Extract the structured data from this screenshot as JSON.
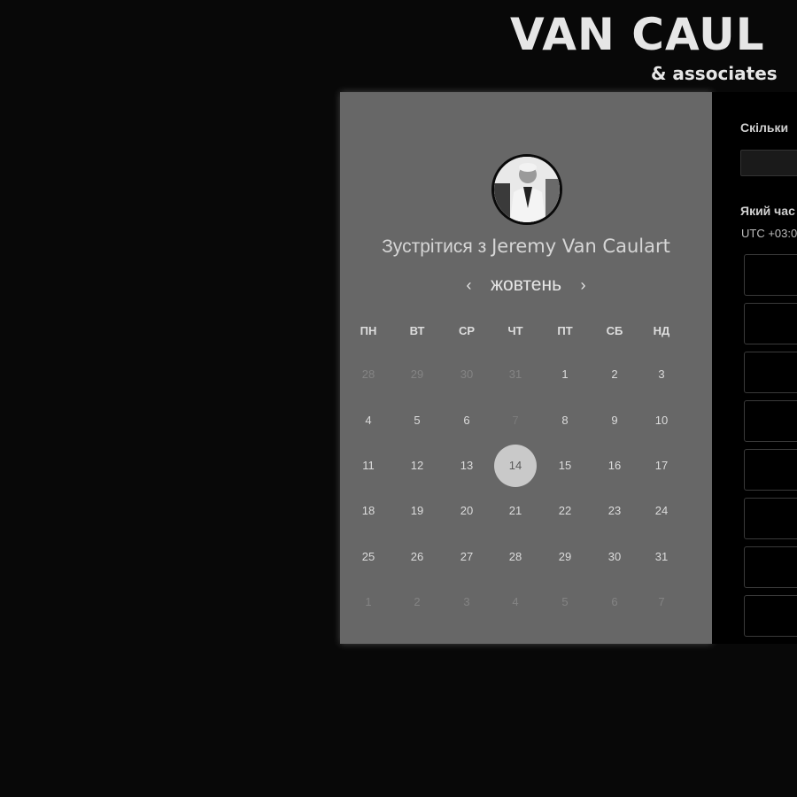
{
  "brand": {
    "logo_main": "VAN CAUL",
    "logo_sub": "& associates"
  },
  "booking": {
    "meet_prefix": "Зустрітися з",
    "host_name": "Jeremy Van Caulart",
    "month": "жовтень",
    "prev_icon": "‹",
    "next_icon": "›"
  },
  "calendar": {
    "weekdays": [
      "ПН",
      "ВТ",
      "СР",
      "ЧТ",
      "ПТ",
      "СБ",
      "НД"
    ],
    "selected_day": "14",
    "weeks": [
      [
        {
          "d": "28",
          "s": "muted"
        },
        {
          "d": "29",
          "s": "muted"
        },
        {
          "d": "30",
          "s": "muted"
        },
        {
          "d": "31",
          "s": "muted"
        },
        {
          "d": "1",
          "s": "normal"
        },
        {
          "d": "2",
          "s": "normal"
        },
        {
          "d": "3",
          "s": "normal"
        }
      ],
      [
        {
          "d": "4",
          "s": "normal"
        },
        {
          "d": "5",
          "s": "normal"
        },
        {
          "d": "6",
          "s": "normal"
        },
        {
          "d": "7",
          "s": "disabled"
        },
        {
          "d": "8",
          "s": "normal"
        },
        {
          "d": "9",
          "s": "normal"
        },
        {
          "d": "10",
          "s": "normal"
        }
      ],
      [
        {
          "d": "11",
          "s": "normal"
        },
        {
          "d": "12",
          "s": "normal"
        },
        {
          "d": "13",
          "s": "normal"
        },
        {
          "d": "14",
          "s": "selected"
        },
        {
          "d": "15",
          "s": "normal"
        },
        {
          "d": "16",
          "s": "normal"
        },
        {
          "d": "17",
          "s": "normal"
        }
      ],
      [
        {
          "d": "18",
          "s": "normal"
        },
        {
          "d": "19",
          "s": "normal"
        },
        {
          "d": "20",
          "s": "normal"
        },
        {
          "d": "21",
          "s": "normal"
        },
        {
          "d": "22",
          "s": "normal"
        },
        {
          "d": "23",
          "s": "normal"
        },
        {
          "d": "24",
          "s": "normal"
        }
      ],
      [
        {
          "d": "25",
          "s": "normal"
        },
        {
          "d": "26",
          "s": "normal"
        },
        {
          "d": "27",
          "s": "normal"
        },
        {
          "d": "28",
          "s": "normal"
        },
        {
          "d": "29",
          "s": "normal"
        },
        {
          "d": "30",
          "s": "normal"
        },
        {
          "d": "31",
          "s": "normal"
        }
      ],
      [
        {
          "d": "1",
          "s": "muted"
        },
        {
          "d": "2",
          "s": "muted"
        },
        {
          "d": "3",
          "s": "muted"
        },
        {
          "d": "4",
          "s": "muted"
        },
        {
          "d": "5",
          "s": "muted"
        },
        {
          "d": "6",
          "s": "muted"
        },
        {
          "d": "7",
          "s": "muted"
        }
      ]
    ]
  },
  "side_panel": {
    "duration_question": "Скільки",
    "time_question": "Який час",
    "timezone": "UTC +03:0"
  },
  "colors": {
    "page_bg": "#080808",
    "card_bg": "#676767",
    "selected_day_bg": "#c9c9c9",
    "panel_bg": "#000000"
  }
}
